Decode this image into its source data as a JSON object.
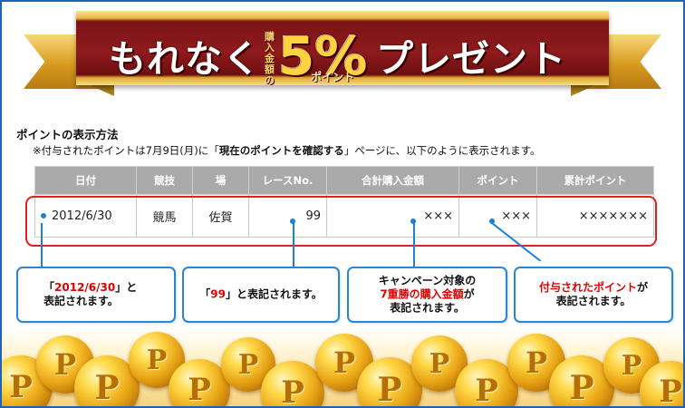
{
  "banner": {
    "title_part1": "もれなく",
    "vertical": [
      "購",
      "入",
      "金",
      "額",
      "の"
    ],
    "percent": "5%",
    "point_small": "ポイント",
    "title_part2": "プレゼント"
  },
  "section": {
    "title": "ポイントの表示方法",
    "note_prefix": "※付与されたポイントは",
    "note_date": "7月9日(月)",
    "note_mid": "に「",
    "note_bold": "現在のポイントを確認する",
    "note_suffix": "」ページに、以下のように表示されます。"
  },
  "table": {
    "headers": [
      "日付",
      "競技",
      "場",
      "レースNo.",
      "合計購入金額",
      "ポイント",
      "累計ポイント"
    ],
    "row": {
      "date": "2012/6/30",
      "sport": "競馬",
      "venue": "佐賀",
      "race_no": "99",
      "total": "×××",
      "point": "×××",
      "cumulative": "×××××××"
    }
  },
  "callouts": {
    "date": {
      "q_open": "「",
      "value": "2012/6/30",
      "q_close": "」と",
      "line2": "表記されます。"
    },
    "race": {
      "q_open": "「",
      "value": "99",
      "rest": "」と表記されます。"
    },
    "amount": {
      "line1": "キャンペーン対象の",
      "highlight": "7重勝の購入金額",
      "tail": "が",
      "line3": "表記されます。"
    },
    "point": {
      "highlight": "付与されたポイント",
      "tail": "が",
      "line2": "表記されます。"
    }
  },
  "colors": {
    "frame": "#1e63b8",
    "ribbon": "#8e1b1d",
    "gold": "#e6b43c",
    "highlight_red": "#e10000",
    "outline_red": "#e02020",
    "callout_blue": "#2a86d4",
    "header_gray": "#aaaaaa"
  },
  "icons": {
    "coin": "P"
  }
}
